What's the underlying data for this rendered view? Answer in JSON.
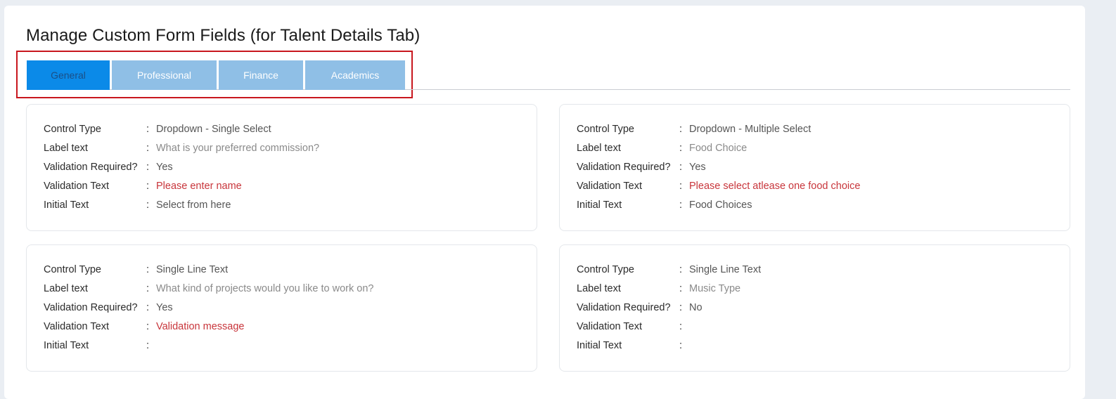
{
  "page": {
    "title": "Manage Custom Form Fields (for Talent Details Tab)"
  },
  "tabs": [
    {
      "label": "General",
      "active": true
    },
    {
      "label": "Professional",
      "active": false
    },
    {
      "label": "Finance",
      "active": false
    },
    {
      "label": "Academics",
      "active": false
    }
  ],
  "field_labels": {
    "control_type": "Control Type",
    "label_text": "Label text",
    "validation_required": "Validation Required?",
    "validation_text": "Validation Text",
    "initial_text": "Initial Text",
    "separator": ":"
  },
  "cards": [
    {
      "control_type": "Dropdown - Single Select",
      "label_text": "What is your preferred commission?",
      "validation_required": "Yes",
      "validation_text": "Please enter name",
      "initial_text": "Select from here"
    },
    {
      "control_type": "Dropdown - Multiple Select",
      "label_text": "Food Choice",
      "validation_required": "Yes",
      "validation_text": "Please select atlease one food choice",
      "initial_text": "Food Choices"
    },
    {
      "control_type": "Single Line Text",
      "label_text": "What kind of projects would you like to work on?",
      "validation_required": "Yes",
      "validation_text": "Validation message",
      "initial_text": ""
    },
    {
      "control_type": "Single Line Text",
      "label_text": "Music Type",
      "validation_required": "No",
      "validation_text": "",
      "initial_text": ""
    }
  ],
  "colors": {
    "tab_active_bg": "#0b8ae8",
    "tab_inactive_bg": "#8fbfe6",
    "highlight_border": "#c8171e",
    "validation_text": "#c8353b"
  }
}
